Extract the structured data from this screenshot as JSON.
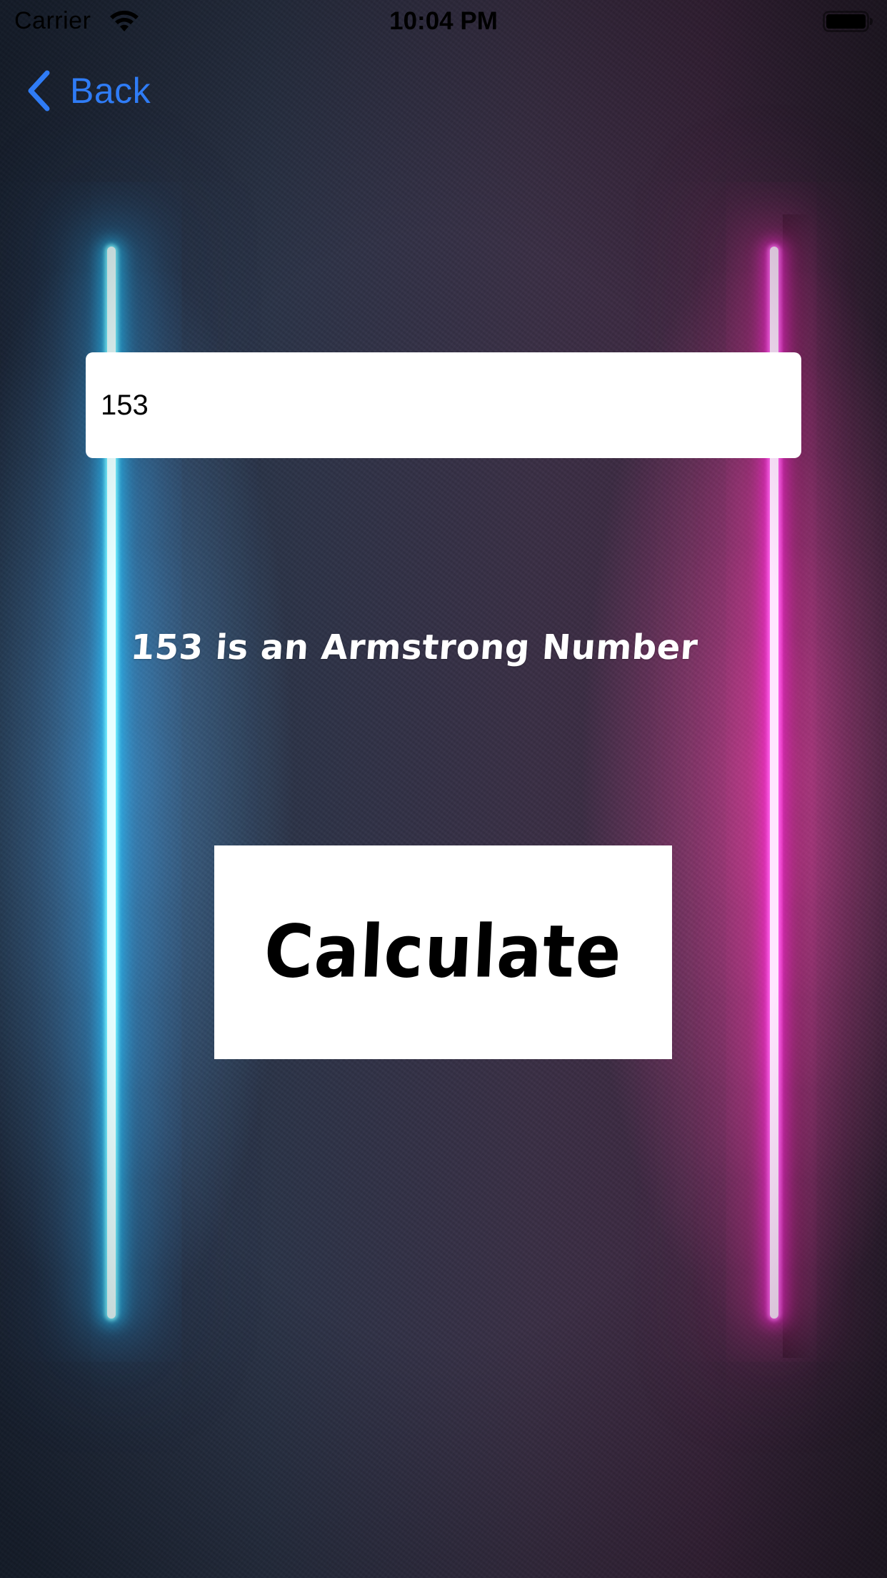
{
  "status_bar": {
    "carrier": "Carrier",
    "time": "10:04 PM",
    "wifi_icon": "wifi-icon",
    "battery_icon": "battery-full-icon"
  },
  "nav": {
    "back_label": "Back",
    "back_icon": "chevron-left-icon",
    "accent_color": "#2f7cf6"
  },
  "input": {
    "value": "153",
    "placeholder": ""
  },
  "result": {
    "text": "153 is an Armstrong Number"
  },
  "actions": {
    "calculate_label": "Calculate"
  },
  "colors": {
    "neon_left": "#4fe6ff",
    "neon_right": "#ff3de0",
    "text_on_background": "#ffffff"
  }
}
